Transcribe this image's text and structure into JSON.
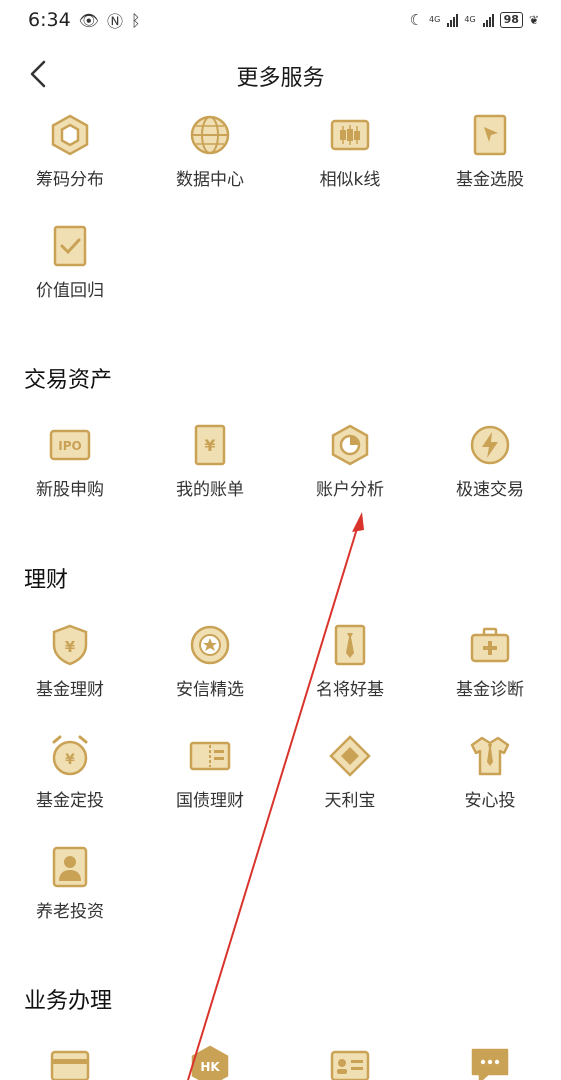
{
  "status_bar": {
    "time": "6:34",
    "sig1_label": "4G",
    "sig2_label": "4G",
    "battery": "98"
  },
  "nav": {
    "title": "更多服务"
  },
  "colors": {
    "icon_gold": "#c9a255",
    "icon_light": "#f1dfb4",
    "arrow": "#d9342b"
  },
  "tools": [
    {
      "label": "筹码分布",
      "icon": "hexagon-chip-icon"
    },
    {
      "label": "数据中心",
      "icon": "globe-icon"
    },
    {
      "label": "相似k线",
      "icon": "candlestick-icon"
    },
    {
      "label": "基金选股",
      "icon": "cursor-page-icon"
    },
    {
      "label": "价值回归",
      "icon": "check-page-icon"
    }
  ],
  "sections": {
    "trade": {
      "title": "交易资产",
      "items": [
        {
          "label": "新股申购",
          "icon": "ipo-icon"
        },
        {
          "label": "我的账单",
          "icon": "yuan-bill-icon"
        },
        {
          "label": "账户分析",
          "icon": "pie-hexagon-icon"
        },
        {
          "label": "极速交易",
          "icon": "lightning-icon"
        }
      ]
    },
    "wealth": {
      "title": "理财",
      "items": [
        {
          "label": "基金理财",
          "icon": "yuan-shield-icon"
        },
        {
          "label": "安信精选",
          "icon": "star-badge-icon"
        },
        {
          "label": "名将好基",
          "icon": "tie-icon"
        },
        {
          "label": "基金诊断",
          "icon": "medkit-icon"
        },
        {
          "label": "基金定投",
          "icon": "alarm-clock-icon"
        },
        {
          "label": "国债理财",
          "icon": "ticket-icon"
        },
        {
          "label": "天利宝",
          "icon": "diamond-icon"
        },
        {
          "label": "安心投",
          "icon": "shirt-icon"
        },
        {
          "label": "养老投资",
          "icon": "portrait-icon"
        }
      ]
    },
    "business": {
      "title": "业务办理",
      "items": [
        {
          "label": "",
          "icon": "card-icon"
        },
        {
          "label": "",
          "icon": "hk-icon"
        },
        {
          "label": "",
          "icon": "id-card-icon"
        },
        {
          "label": "",
          "icon": "chat-icon"
        }
      ]
    }
  }
}
